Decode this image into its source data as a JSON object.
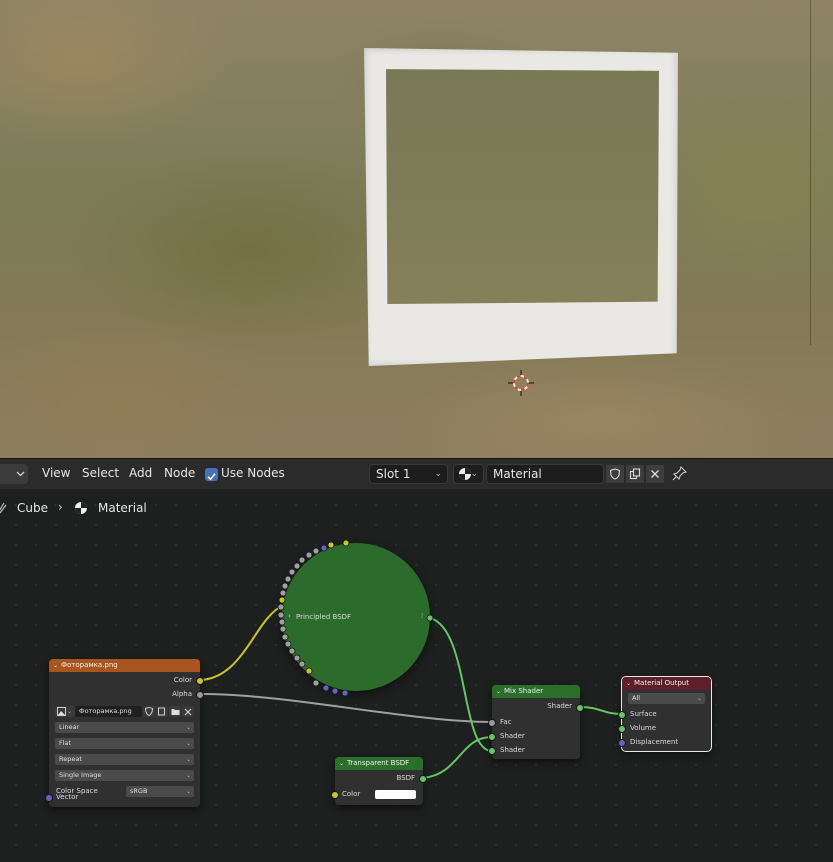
{
  "header": {
    "menu": [
      "View",
      "Select",
      "Add",
      "Node"
    ],
    "use_nodes_label": "Use Nodes",
    "use_nodes_checked": true,
    "slot": "Slot 1",
    "material_name": "Material"
  },
  "breadcrumb": {
    "object": "Cube",
    "material": "Material"
  },
  "nodes": {
    "image": {
      "title": "Фоторамка.png",
      "out_color": "Color",
      "out_alpha": "Alpha",
      "image_name": "Фоторамка.png",
      "interpolation": "Linear",
      "projection": "Flat",
      "extension": "Repeat",
      "source": "Single Image",
      "color_space_label": "Color Space",
      "color_space": "sRGB",
      "in_vector": "Vector"
    },
    "principled": {
      "title": "Principled BSDF"
    },
    "transparent": {
      "title": "Transparent BSDF",
      "out_bsdf": "BSDF",
      "in_color": "Color"
    },
    "mix": {
      "title": "Mix Shader",
      "out_shader": "Shader",
      "in_fac": "Fac",
      "in_shader1": "Shader",
      "in_shader2": "Shader"
    },
    "output": {
      "title": "Material Output",
      "target": "All",
      "in_surface": "Surface",
      "in_volume": "Volume",
      "in_displacement": "Displacement"
    }
  },
  "colors": {
    "texture_header": "#a8551f",
    "shader_header": "#2c6e2c",
    "output_header": "#5e1f2a",
    "accent": "#4772b3"
  }
}
